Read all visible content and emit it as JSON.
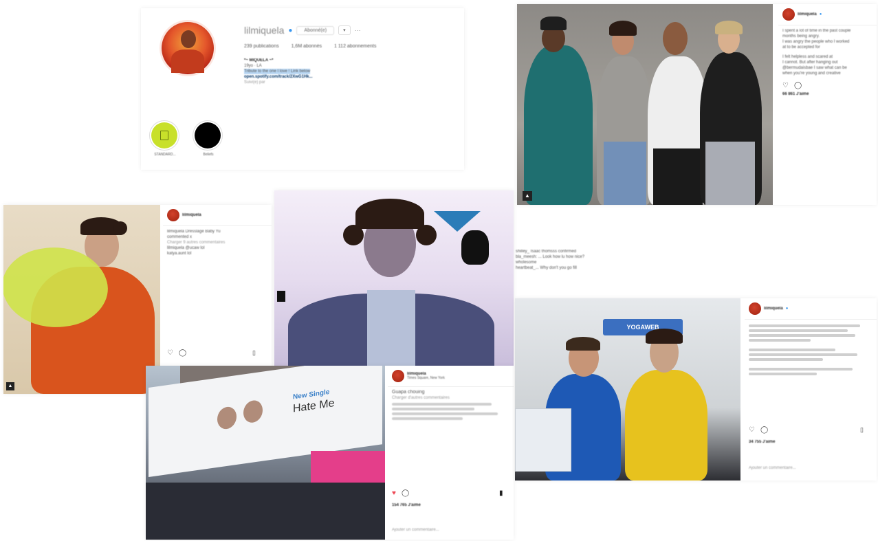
{
  "profile": {
    "username": "lilmiquela",
    "follow_label": "Abonné(e)",
    "stats": [
      "239 publications",
      "1,6M abonnés",
      "1 112 abonnements"
    ],
    "bio_name": "*~ MIQUELA ~*",
    "bio_lines": [
      "19yo · LA",
      "Tribute to the one I love ! Link below",
      "open.spotify.com/track/2XwG1Hk..."
    ],
    "followed_by": "Suivi(e) par",
    "highlights": [
      {
        "label": "STANDARD..."
      },
      {
        "label": "Beliefs"
      }
    ]
  },
  "posts": {
    "group_post": {
      "username": "lilmiquela",
      "lines": [
        "I spent a lot of time in the past couple",
        "months being angry.",
        "I was angry the people who I worked",
        "at to be accepted for",
        "I felt helpless and scared at",
        "I cannot. But after hanging out",
        "@bermudaisbae I saw what can be",
        "when you're young and creative"
      ],
      "likes": "66 861 J'aime",
      "comments": [
        "shilley_ Isaac thomsss confirmed",
        "bla_meesh: ... Look how lu how nice?",
        "wholesome",
        "heartbeat_... Why don't you go fill"
      ]
    },
    "shoe_post": {
      "username": "lilmiquela",
      "lines": [
        "lilmiquela Dresslage Baby Yu",
        "commented x",
        "Charger 9 autres commentaires",
        "lilmiquela @ucaw lol",
        "katya.aunt lol"
      ]
    },
    "billboard_post": {
      "username": "lilmiquela",
      "location": "Times Square, New York",
      "caption": "Guapa chouing",
      "more": "Charger d'autres commentaires",
      "ad_title": "New Single",
      "ad_name": "Hate Me",
      "likes": "154 765 J'aime",
      "add_comment": "Ajouter un commentaire..."
    },
    "studio_post": {
      "username": "lilmiquela",
      "banner": "YOGAWEB",
      "likes": "34 755 J'aime",
      "add_comment": "Ajouter un commentaire..."
    }
  },
  "colors": {
    "verified": "#3897f0",
    "link": "#003569",
    "highlight_green": "#c8e02a"
  }
}
